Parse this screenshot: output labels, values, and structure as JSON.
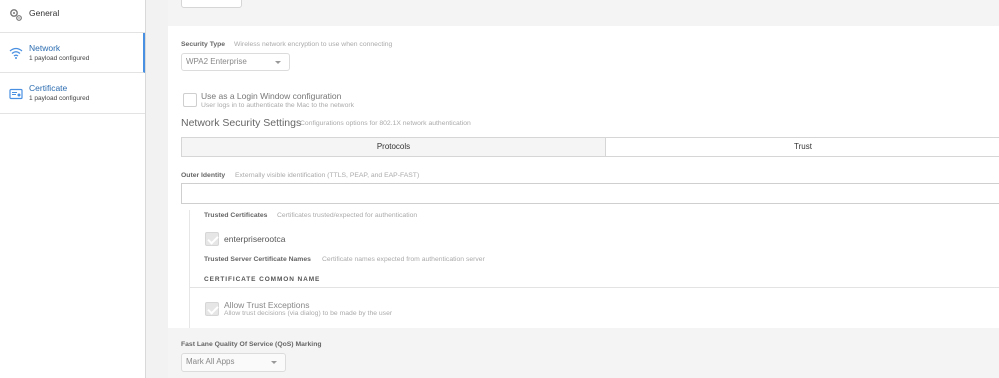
{
  "sidebar": {
    "items": [
      {
        "label": "General",
        "sub": "",
        "icon": "gear-icon"
      },
      {
        "label": "Network",
        "sub": "1 payload configured",
        "icon": "wifi-icon"
      },
      {
        "label": "Certificate",
        "sub": "1 payload configured",
        "icon": "certificate-icon"
      }
    ]
  },
  "security": {
    "label": "Security Type",
    "hint": "Wireless network encryption to use when connecting",
    "value": "WPA2 Enterprise"
  },
  "login_window": {
    "label": "Use as a Login Window configuration",
    "hint": "User logs in to authenticate the Mac to the network"
  },
  "network_security": {
    "title": "Network Security Settings",
    "hint": "Configurations options for 802.1X network authentication"
  },
  "tabs": [
    {
      "label": "Protocols"
    },
    {
      "label": "Trust"
    }
  ],
  "outer_identity": {
    "label": "Outer Identity",
    "hint": "Externally visible identification (TTLS, PEAP, and EAP-FAST)",
    "value": ""
  },
  "trusted_certs": {
    "label": "Trusted Certificates",
    "hint": "Certificates trusted/expected for authentication",
    "items": [
      "enterpriserootca"
    ]
  },
  "trusted_server_names": {
    "label": "Trusted Server Certificate Names",
    "hint": "Certificate names expected from authentication server",
    "column_header": "CERTIFICATE COMMON NAME"
  },
  "trust_exceptions": {
    "label": "Allow Trust Exceptions",
    "hint": "Allow trust decisions (via dialog) to be made by the user"
  },
  "qos": {
    "label": "Fast Lane Quality Of Service (QoS) Marking",
    "value": "Mark All Apps"
  },
  "colors": {
    "accent": "#2b6cb0",
    "selected_border": "#4a90e2"
  }
}
